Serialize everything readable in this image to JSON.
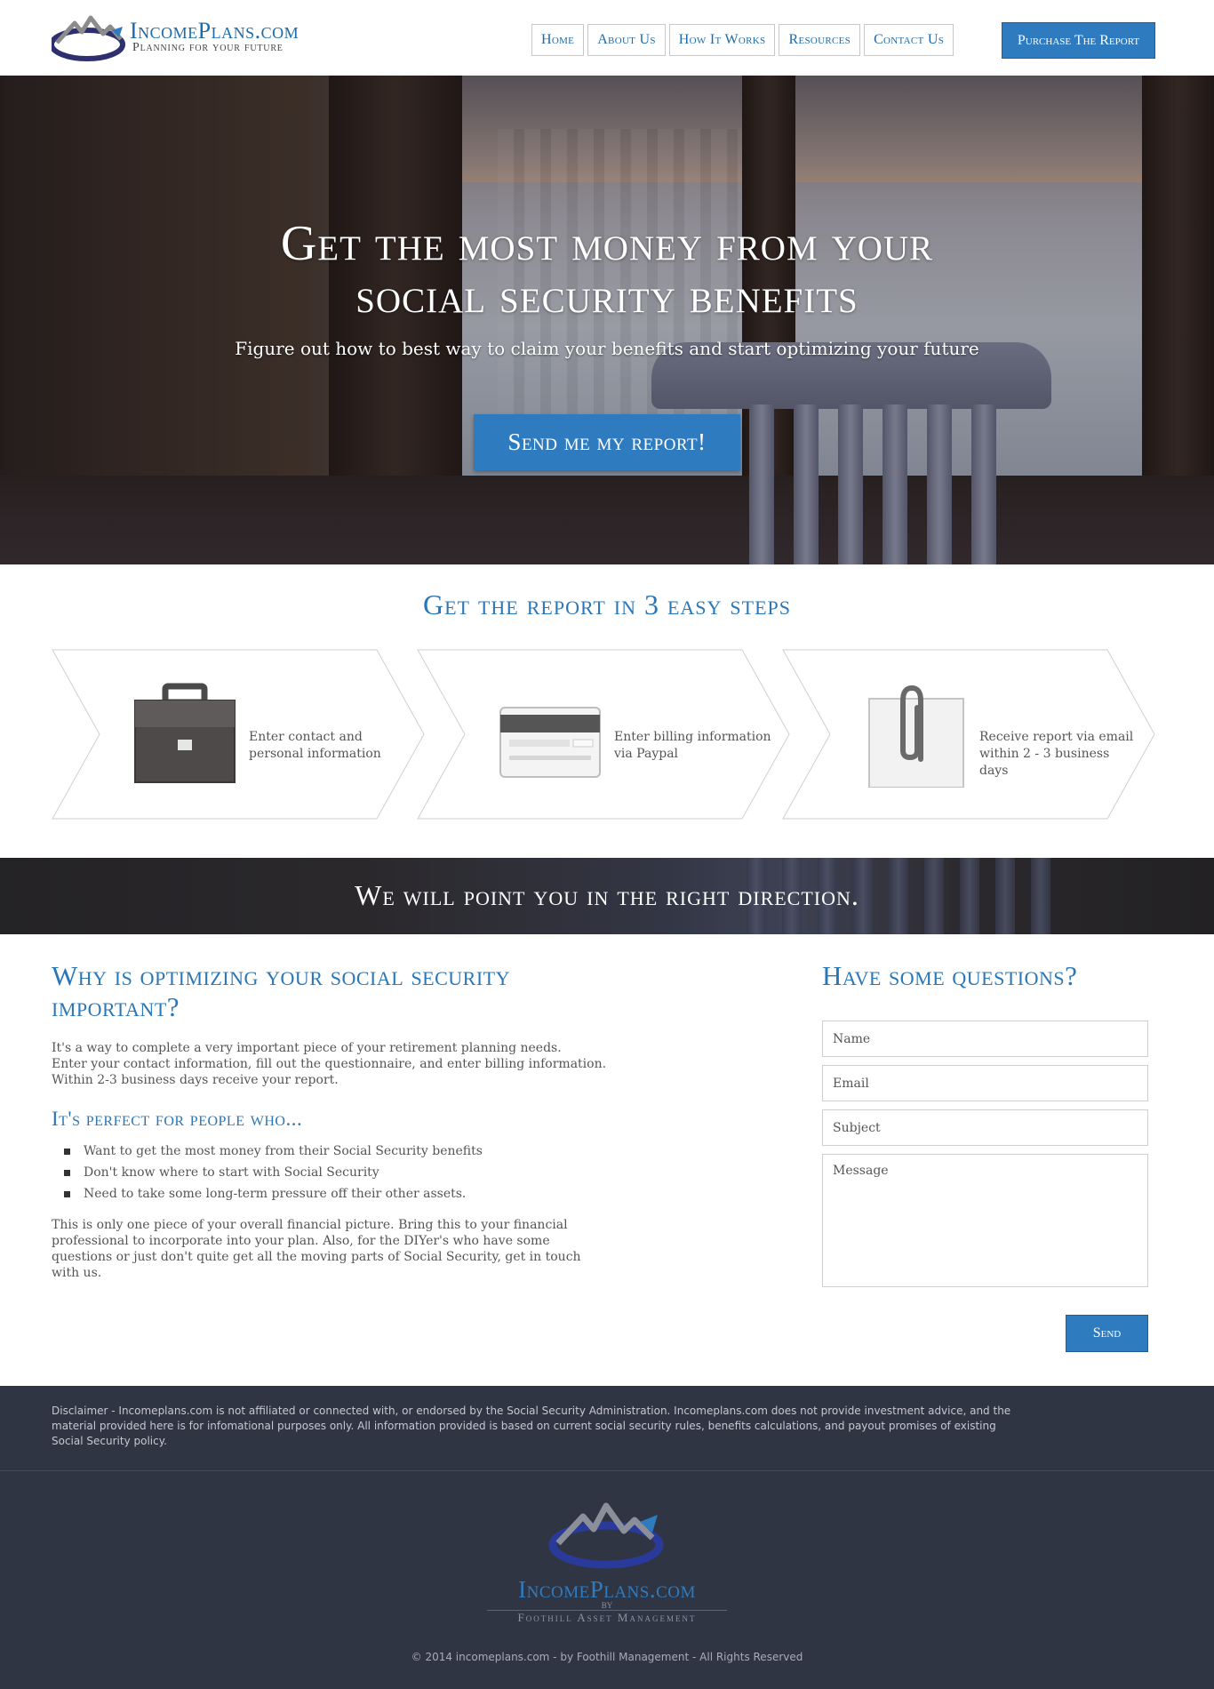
{
  "brand": {
    "name": "IncomePlans.com",
    "tagline": "Planning for your future"
  },
  "nav": {
    "items": [
      "Home",
      "About Us",
      "How It Works",
      "Resources",
      "Contact Us"
    ],
    "cta": "Purchase The Report"
  },
  "hero": {
    "title_line1": "Get the most money from your",
    "title_line2": "social security benefits",
    "subtitle": "Figure out how to best way to claim your benefits and start optimizing your future",
    "button": "Send me my report!"
  },
  "steps": {
    "title": "Get the report in 3 easy steps",
    "items": [
      {
        "icon": "briefcase-icon",
        "text": "Enter contact and personal information"
      },
      {
        "icon": "credit-card-icon",
        "text": "Enter billing information via Paypal"
      },
      {
        "icon": "paperclip-icon",
        "text": "Receive report via email within 2 - 3 business days"
      }
    ]
  },
  "band": {
    "text": "We will point you in the right direction."
  },
  "why": {
    "title": "Why is optimizing your social security important?",
    "intro_lines": [
      "It's a way to complete a very important piece of your retirement planning needs.",
      "Enter your contact information, fill out the questionnaire, and enter billing information.",
      "Within 2-3 business days receive your report."
    ],
    "perfect_title": "It's perfect for people who...",
    "perfect_items": [
      "Want to get the most money from their Social Security benefits",
      "Don't know where to start with Social Security",
      "Need to take some long-term pressure off their other assets."
    ],
    "outro": "This is only one piece of your overall financial picture. Bring this to your financial professional to incorporate into your plan. Also, for the DIYer's who have some questions or just don't quite get all the moving parts of Social Security, get in touch with us."
  },
  "contact": {
    "title": "Have some questions?",
    "name_placeholder": "Name",
    "email_placeholder": "Email",
    "subject_placeholder": "Subject",
    "message_placeholder": "Message",
    "send": "Send"
  },
  "footer": {
    "disclaimer": "Disclaimer - Incomeplans.com is not affiliated or connected with, or endorsed by the Social Security Administration. Incomeplans.com does not provide investment advice, and the material provided here is for infomational purposes only. All information provided is based on current social security rules, benefits calculations, and payout promises of existing Social Security policy.",
    "logo_name": "IncomePlans.com",
    "logo_by": "BY",
    "logo_sub": "Foothill Asset Management",
    "copyright": "© 2014 incomeplans.com - by Foothill Management - All Rights Reserved"
  },
  "colors": {
    "accent": "#2f7bbf",
    "heading_blue": "#2a77b8",
    "footer_bg": "#303543"
  }
}
